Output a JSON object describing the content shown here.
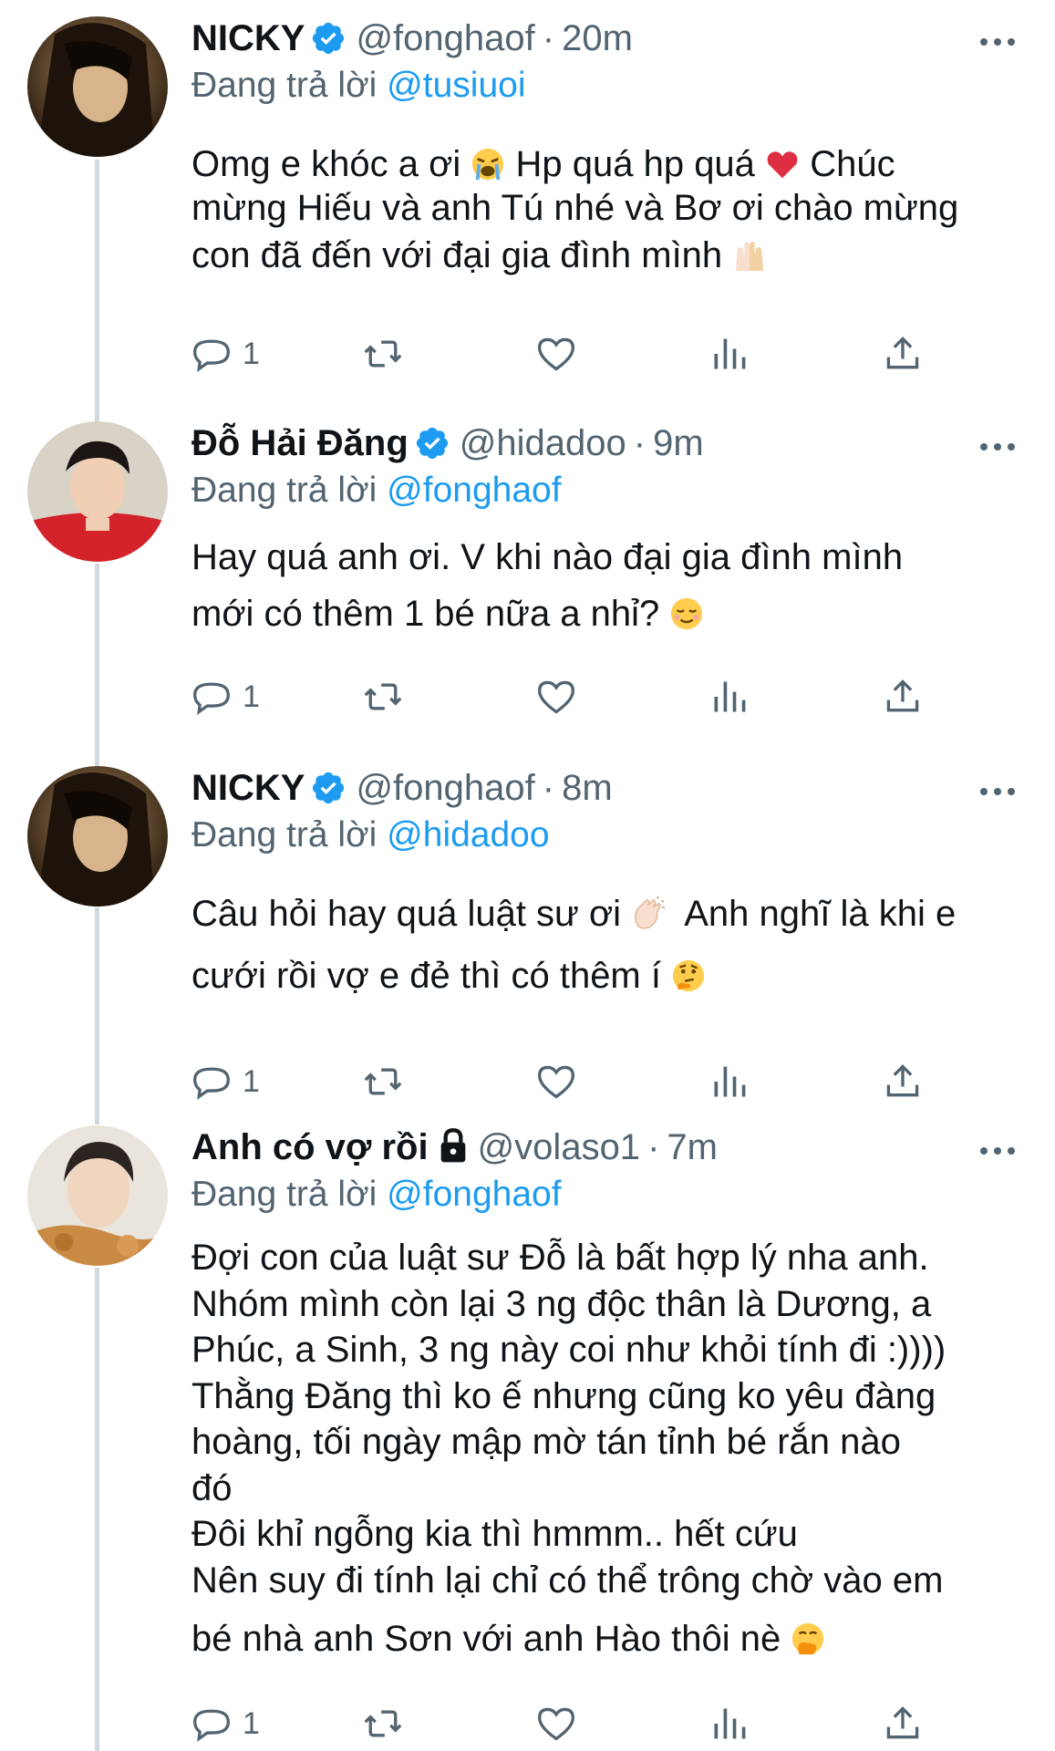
{
  "tweets": [
    {
      "name": "NICKY",
      "verified": true,
      "protected": false,
      "handle": "@fonghaof",
      "time": "20m",
      "replying_prefix": "Đang trả lời",
      "replying_to": "@tusiuoi",
      "lines": [
        "Omg e khóc a ơi",
        "Hp quá hp quá",
        "Chúc",
        "mừng Hiếu và anh Tú nhé và Bơ ơi chào mừng",
        "con đã đến với đại gia đình mình"
      ],
      "reply_count": "1",
      "avatar": "dark-portrait"
    },
    {
      "name": "Đỗ Hải Đăng",
      "verified": true,
      "protected": false,
      "handle": "@hidadoo",
      "time": "9m",
      "replying_prefix": "Đang trả lời",
      "replying_to": "@fonghaof",
      "lines": [
        "Hay quá anh ơi. V khi nào đại gia đình mình",
        "mới có thêm 1 bé nữa a nhỉ?"
      ],
      "reply_count": "1",
      "avatar": "red-jacket-portrait"
    },
    {
      "name": "NICKY",
      "verified": true,
      "protected": false,
      "handle": "@fonghaof",
      "time": "8m",
      "replying_prefix": "Đang trả lời",
      "replying_to": "@hidadoo",
      "lines": [
        "Câu hỏi hay quá luật sư ơi",
        "Anh nghĩ là khi e",
        "cưới rồi vợ e đẻ thì có thêm í"
      ],
      "reply_count": "1",
      "avatar": "dark-portrait"
    },
    {
      "name": "Anh có vợ rồi",
      "verified": false,
      "protected": true,
      "handle": "@volaso1",
      "time": "7m",
      "replying_prefix": "Đang trả lời",
      "replying_to": "@fonghaof",
      "lines": [
        "Đợi con của luật sư Đỗ là bất hợp lý nha anh.",
        "Nhóm mình còn lại 3 ng độc thân là Dương, a",
        "Phúc, a Sinh, 3 ng này coi như khỏi tính đi :))))",
        "Thằng Đăng thì ko ế nhưng cũng ko yêu đàng",
        "hoàng, tối ngày mập mờ tán tỉnh bé rắn nào",
        "đó",
        "Đôi khỉ ngỗng kia thì hmmm.. hết cứu",
        "Nên suy đi tính lại chỉ có thể trông chờ vào em",
        "bé nhà anh Sơn với anh Hào thôi nè"
      ],
      "reply_count": "1",
      "avatar": "light-portrait"
    }
  ],
  "colors": {
    "accent": "#1d9bf0",
    "secondary": "#536471",
    "thread": "#cfd9de"
  }
}
